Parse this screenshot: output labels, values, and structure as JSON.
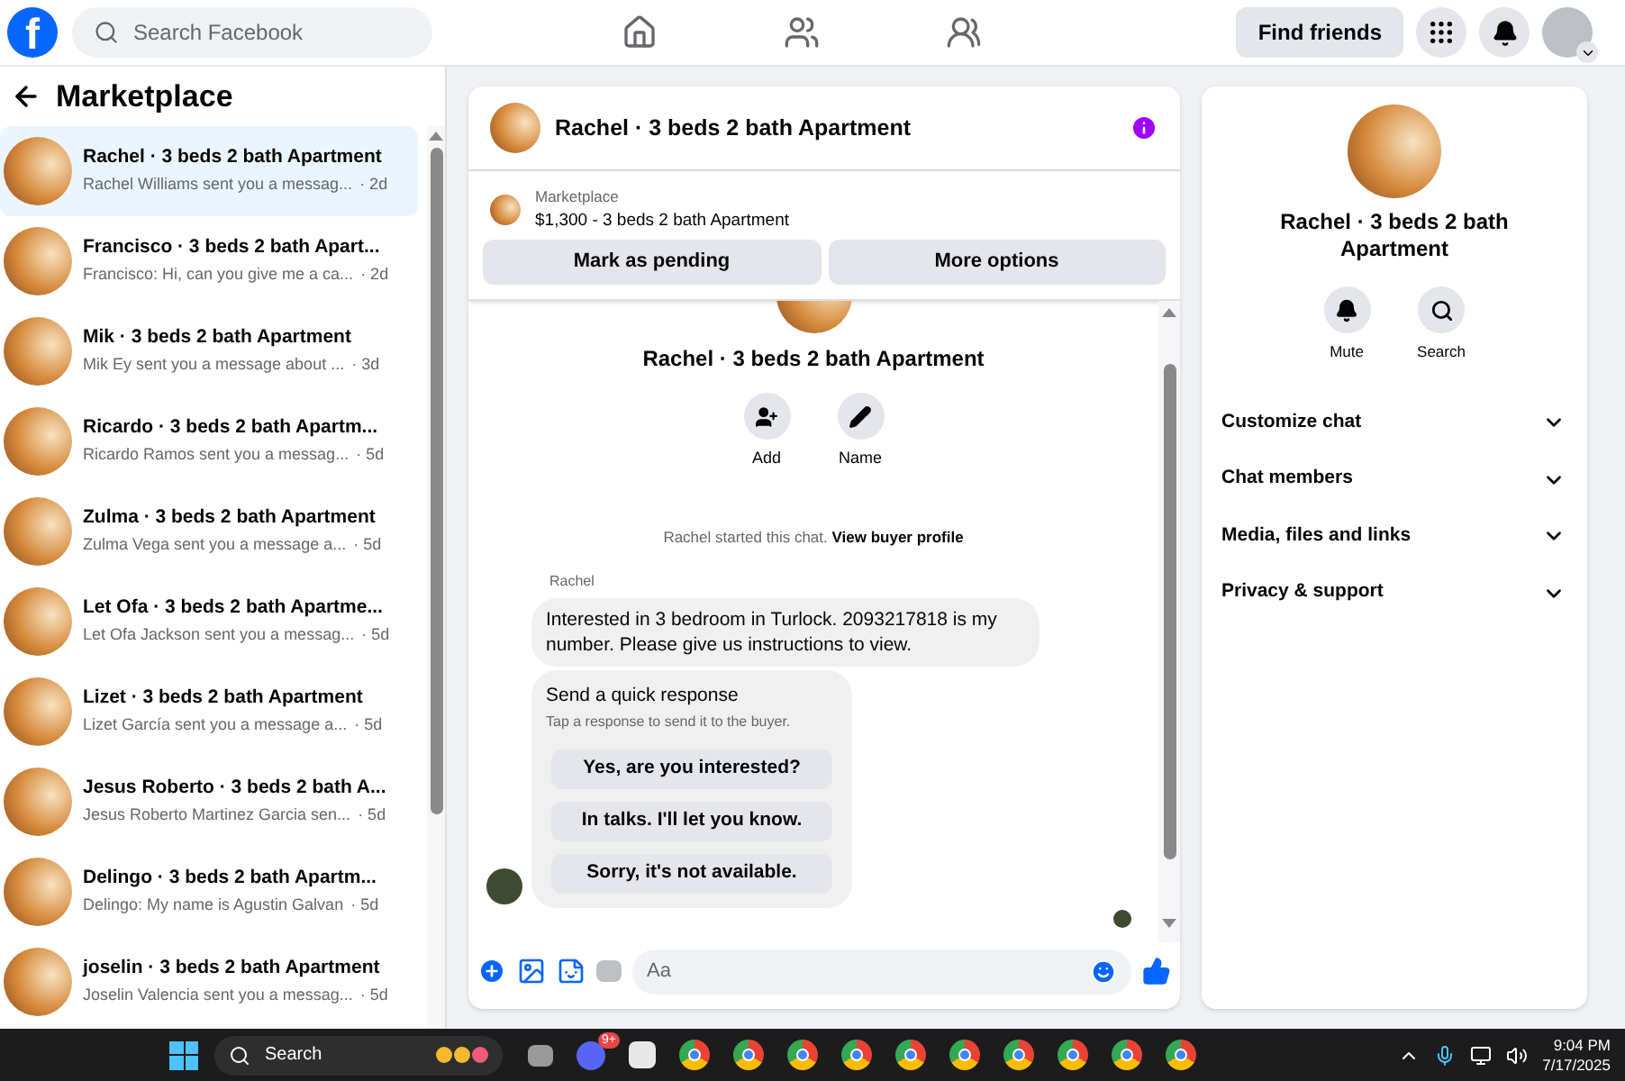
{
  "topbar": {
    "logo": "f",
    "search_placeholder": "Search Facebook",
    "find_friends": "Find friends"
  },
  "sidebar": {
    "title": "Marketplace",
    "conversations": [
      {
        "title": "Rachel · 3 beds 2 bath Apartment",
        "preview": "Rachel Williams sent you a messag...",
        "time": "· 2d",
        "selected": true
      },
      {
        "title": "Francisco · 3 beds 2 bath Apart...",
        "preview": "Francisco: Hi, can you give me a ca...",
        "time": "· 2d",
        "selected": false
      },
      {
        "title": "Mik · 3 beds 2 bath Apartment",
        "preview": "Mik Ey sent you a message about ...",
        "time": "· 3d",
        "selected": false
      },
      {
        "title": "Ricardo · 3 beds 2 bath Apartm...",
        "preview": "Ricardo Ramos sent you a messag...",
        "time": "· 5d",
        "selected": false
      },
      {
        "title": "Zulma · 3 beds 2 bath Apartment",
        "preview": "Zulma Vega sent you a message a...",
        "time": "· 5d",
        "selected": false
      },
      {
        "title": "Let Ofa · 3 beds 2 bath Apartme...",
        "preview": "Let Ofa Jackson sent you a messag...",
        "time": "· 5d",
        "selected": false
      },
      {
        "title": "Lizet · 3 beds 2 bath Apartment",
        "preview": "Lizet García sent you a message a...",
        "time": "· 5d",
        "selected": false
      },
      {
        "title": "Jesus Roberto · 3 beds 2 bath A...",
        "preview": "Jesus Roberto Martinez Garcia sen...",
        "time": "· 5d",
        "selected": false
      },
      {
        "title": "Delingo · 3 beds 2 bath Apartm...",
        "preview": "Delingo: My name is Agustin Galvan",
        "time": "· 5d",
        "selected": false
      },
      {
        "title": "joselin · 3 beds 2 bath Apartment",
        "preview": "Joselin Valencia sent you a messag...",
        "time": "· 5d",
        "selected": false
      }
    ]
  },
  "chat": {
    "title": "Rachel · 3 beds 2 bath Apartment",
    "listing": {
      "label": "Marketplace",
      "summary": "$1,300 - 3 beds 2 bath Apartment"
    },
    "actions": [
      "Mark as pending",
      "More options"
    ],
    "profile_name": "Rachel · 3 beds 2 bath Apartment",
    "profile_actions": [
      {
        "kind": "add",
        "label": "Add"
      },
      {
        "kind": "name",
        "label": "Name"
      }
    ],
    "note": {
      "text": "Rachel started this chat.",
      "link": "View buyer profile"
    },
    "sender": "Rachel",
    "message": "Interested in 3 bedroom in Turlock. 2093217818 is my number. Please give us instructions to view.",
    "quick_response": {
      "title": "Send a quick response",
      "subtitle": "Tap a response to send it to the buyer.",
      "options": [
        "Yes, are you interested?",
        "In talks. I'll let you know.",
        "Sorry, it's not available."
      ]
    },
    "composer": {
      "placeholder": "Aa"
    }
  },
  "details": {
    "name": "Rachel · 3 beds 2 bath Apartment",
    "actions": [
      {
        "kind": "mute",
        "label": "Mute"
      },
      {
        "kind": "search",
        "label": "Search"
      }
    ],
    "sections": [
      {
        "label": "Customize chat",
        "expanded": false
      },
      {
        "label": "Chat members",
        "expanded": false
      },
      {
        "label": "Media, files and links",
        "expanded": false
      },
      {
        "label": "Privacy & support",
        "expanded": false
      }
    ]
  },
  "taskbar": {
    "search_placeholder": "Search",
    "badge": "9+",
    "time": "9:04 PM",
    "date": "7/17/2025"
  }
}
